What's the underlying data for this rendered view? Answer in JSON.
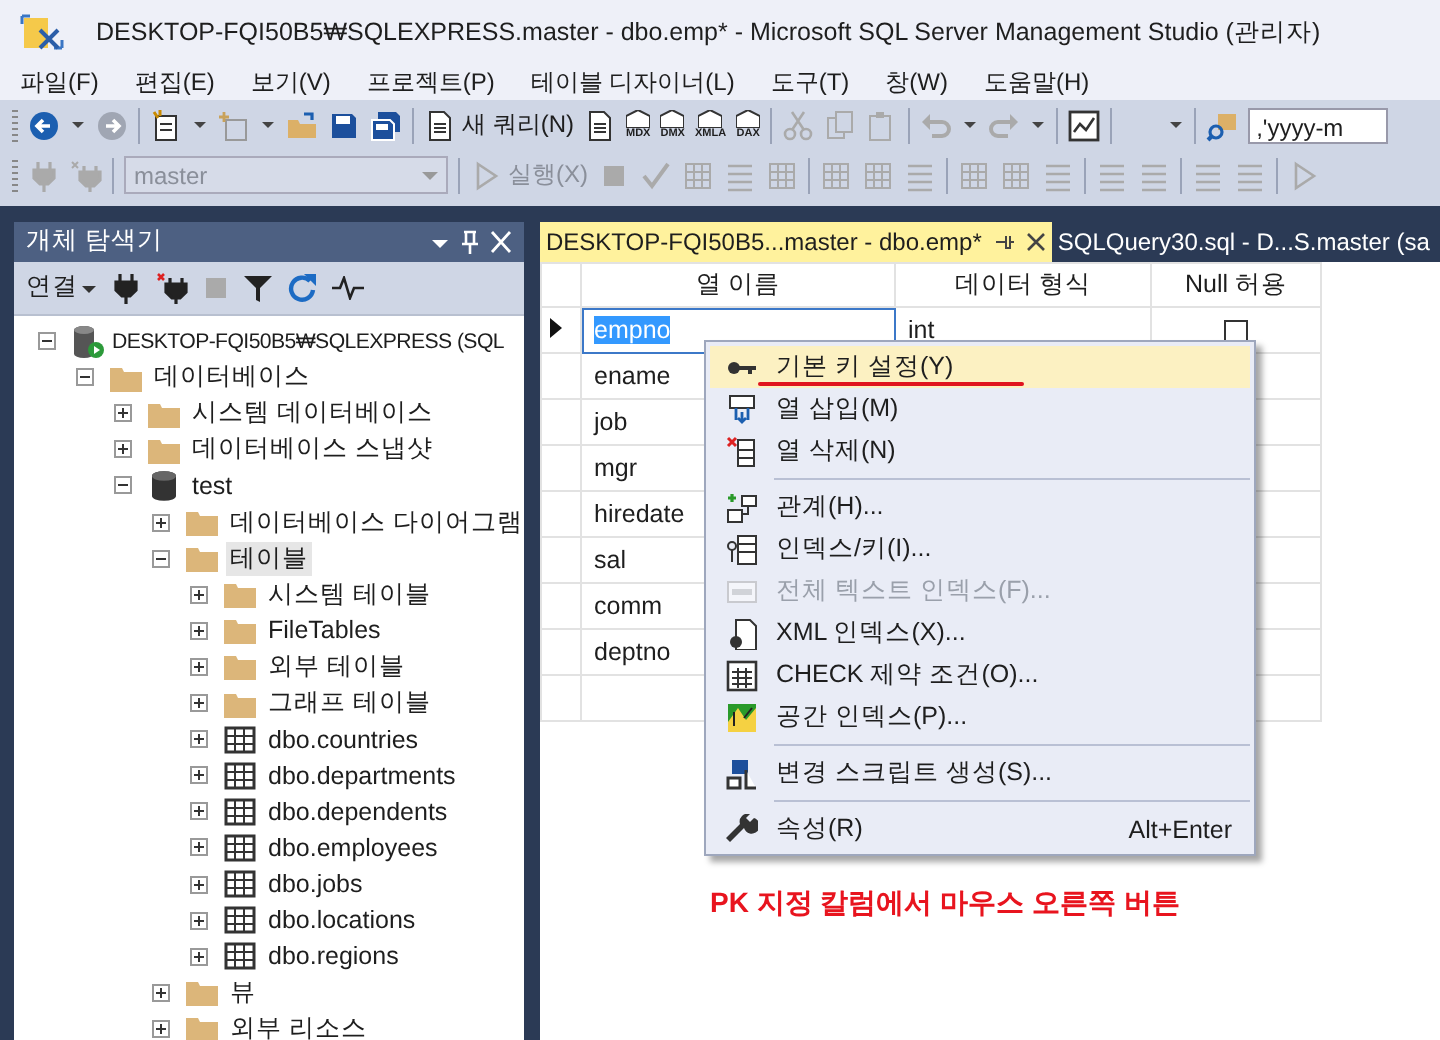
{
  "window": {
    "title": "DESKTOP-FQI50B5₩SQLEXPRESS.master - dbo.emp* - Microsoft SQL Server Management Studio (관리자)"
  },
  "menu": [
    "파일(F)",
    "편집(E)",
    "보기(V)",
    "프로젝트(P)",
    "테이블 디자이너(L)",
    "도구(T)",
    "창(W)",
    "도움말(H)"
  ],
  "toolbar": {
    "new_query": "새 쿼리(N)",
    "query_types": [
      "MDX",
      "DMX",
      "XMLA",
      "DAX"
    ],
    "format_field": ",'yyyy-m"
  },
  "toolbar2": {
    "database": {
      "value": "master",
      "disabled": true
    },
    "execute": {
      "label": "실행(X)",
      "disabled": true
    }
  },
  "object_explorer": {
    "title": "개체 탐색기",
    "connect": "연결",
    "tree": [
      {
        "kind": "server",
        "label": "DESKTOP-FQI50B5₩SQLEXPRESS (SQL",
        "expanded": true,
        "selected": false,
        "children": [
          {
            "kind": "folder",
            "label": "데이터베이스",
            "expanded": true,
            "selected": false,
            "children": [
              {
                "kind": "folder",
                "label": "시스템 데이터베이스",
                "expanded": false,
                "selected": false
              },
              {
                "kind": "folder",
                "label": "데이터베이스 스냅샷",
                "expanded": false,
                "selected": false
              },
              {
                "kind": "database",
                "label": "test",
                "expanded": true,
                "selected": false,
                "children": [
                  {
                    "kind": "folder",
                    "label": "데이터베이스 다이어그램",
                    "expanded": false,
                    "selected": false
                  },
                  {
                    "kind": "folder",
                    "label": "테이블",
                    "expanded": true,
                    "selected": true,
                    "children": [
                      {
                        "kind": "folder",
                        "label": "시스템 테이블",
                        "expanded": false,
                        "selected": false
                      },
                      {
                        "kind": "folder",
                        "label": "FileTables",
                        "expanded": false,
                        "selected": false
                      },
                      {
                        "kind": "folder",
                        "label": "외부 테이블",
                        "expanded": false,
                        "selected": false
                      },
                      {
                        "kind": "folder",
                        "label": "그래프 테이블",
                        "expanded": false,
                        "selected": false
                      },
                      {
                        "kind": "table",
                        "label": "dbo.countries",
                        "expanded": false,
                        "selected": false
                      },
                      {
                        "kind": "table",
                        "label": "dbo.departments",
                        "expanded": false,
                        "selected": false
                      },
                      {
                        "kind": "table",
                        "label": "dbo.dependents",
                        "expanded": false,
                        "selected": false
                      },
                      {
                        "kind": "table",
                        "label": "dbo.employees",
                        "expanded": false,
                        "selected": false
                      },
                      {
                        "kind": "table",
                        "label": "dbo.jobs",
                        "expanded": false,
                        "selected": false
                      },
                      {
                        "kind": "table",
                        "label": "dbo.locations",
                        "expanded": false,
                        "selected": false
                      },
                      {
                        "kind": "table",
                        "label": "dbo.regions",
                        "expanded": false,
                        "selected": false
                      }
                    ]
                  },
                  {
                    "kind": "folder",
                    "label": "뷰",
                    "expanded": false,
                    "selected": false
                  },
                  {
                    "kind": "folder",
                    "label": "외부 리소스",
                    "expanded": false,
                    "selected": false
                  }
                ]
              }
            ]
          }
        ]
      }
    ]
  },
  "tabs": [
    {
      "label": "DESKTOP-FQI50B5...master - dbo.emp*",
      "selected": true
    },
    {
      "label": "SQLQuery30.sql - D...S.master (sa",
      "selected": false
    }
  ],
  "designer": {
    "columns": [
      "열 이름",
      "데이터 형식",
      "Null 허용"
    ],
    "rows": [
      {
        "name": "empno",
        "data_type": "int",
        "allow_nulls": false,
        "selected": true
      },
      {
        "name": "ename",
        "selected": false
      },
      {
        "name": "job",
        "selected": false
      },
      {
        "name": "mgr",
        "selected": false
      },
      {
        "name": "hiredate",
        "selected": false
      },
      {
        "name": "sal",
        "selected": false
      },
      {
        "name": "comm",
        "selected": false
      },
      {
        "name": "deptno",
        "selected": false
      }
    ]
  },
  "context_menu": {
    "items": [
      {
        "kind": "item",
        "label": "기본 키 설정(Y)",
        "selected": true,
        "disabled": false
      },
      {
        "kind": "item",
        "label": "열 삽입(M)",
        "selected": false,
        "disabled": false
      },
      {
        "kind": "item",
        "label": "열 삭제(N)",
        "selected": false,
        "disabled": false
      },
      {
        "kind": "separator"
      },
      {
        "kind": "item",
        "label": "관계(H)...",
        "selected": false,
        "disabled": false
      },
      {
        "kind": "item",
        "label": "인덱스/키(I)...",
        "selected": false,
        "disabled": false
      },
      {
        "kind": "item",
        "label": "전체 텍스트 인덱스(F)...",
        "selected": false,
        "disabled": true
      },
      {
        "kind": "item",
        "label": "XML 인덱스(X)...",
        "selected": false,
        "disabled": false
      },
      {
        "kind": "item",
        "label": "CHECK 제약 조건(O)...",
        "selected": false,
        "disabled": false
      },
      {
        "kind": "item",
        "label": "공간 인덱스(P)...",
        "selected": false,
        "disabled": false
      },
      {
        "kind": "separator"
      },
      {
        "kind": "item",
        "label": "변경 스크립트 생성(S)...",
        "selected": false,
        "disabled": false
      },
      {
        "kind": "separator"
      },
      {
        "kind": "item",
        "label": "속성(R)",
        "shortcut": "Alt+Enter",
        "selected": false,
        "disabled": false
      }
    ]
  },
  "annotation": {
    "text": "PK 지정 칼럼에서 마우스 오른쪽 버튼"
  }
}
